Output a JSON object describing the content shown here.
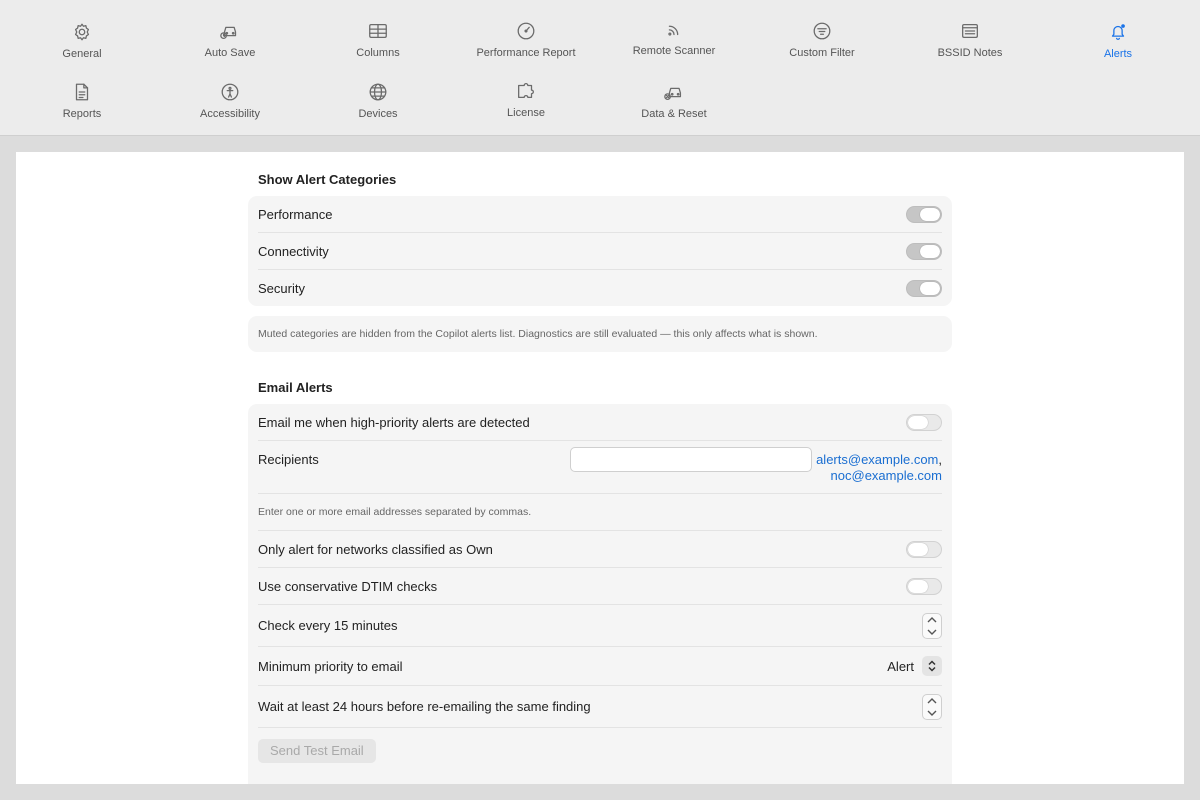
{
  "toolbar": {
    "items": [
      {
        "label": "General",
        "icon": "gear-icon"
      },
      {
        "label": "Auto Save",
        "icon": "car-clock-icon"
      },
      {
        "label": "Columns",
        "icon": "table-icon"
      },
      {
        "label": "Performance Report",
        "icon": "gauge-icon"
      },
      {
        "label": "Remote Scanner",
        "icon": "rss-icon"
      },
      {
        "label": "Custom Filter",
        "icon": "filter-icon"
      },
      {
        "label": "BSSID Notes",
        "icon": "notes-icon"
      },
      {
        "label": "Alerts",
        "icon": "bell-icon"
      },
      {
        "label": "Reports",
        "icon": "document-icon"
      },
      {
        "label": "Accessibility",
        "icon": "accessibility-icon"
      },
      {
        "label": "Devices",
        "icon": "globe-icon"
      },
      {
        "label": "License",
        "icon": "puzzle-icon"
      },
      {
        "label": "Data & Reset",
        "icon": "car-reset-icon"
      }
    ],
    "active": "Alerts"
  },
  "categories": {
    "title": "Show Alert Categories",
    "items": [
      {
        "label": "Performance",
        "on": true
      },
      {
        "label": "Connectivity",
        "on": true
      },
      {
        "label": "Security",
        "on": true
      }
    ],
    "note": "Muted categories are hidden from the Copilot alerts list. Diagnostics are still evaluated — this only affects what is shown."
  },
  "email": {
    "title": "Email Alerts",
    "enable_label": "Email me when high-priority alerts are detected",
    "enable_on": false,
    "recipients_label": "Recipients",
    "recipients_value": "",
    "recipients_list_1": "alerts@example.com",
    "recipients_comma": ",",
    "recipients_list_2": "noc@example.com",
    "recipients_helper": "Enter one or more email addresses separated by commas.",
    "own_only_label": "Only alert for networks classified as Own",
    "own_only_on": false,
    "dtim_label": "Use conservative DTIM checks",
    "dtim_on": false,
    "interval_label": "Check every 15 minutes",
    "min_priority_label": "Minimum priority to email",
    "min_priority_value": "Alert",
    "wait_label": "Wait at least 24 hours before re-emailing the same finding",
    "send_test_label": "Send Test Email"
  },
  "colors": {
    "accent": "#1a73e8",
    "link": "#1a6ed1"
  }
}
